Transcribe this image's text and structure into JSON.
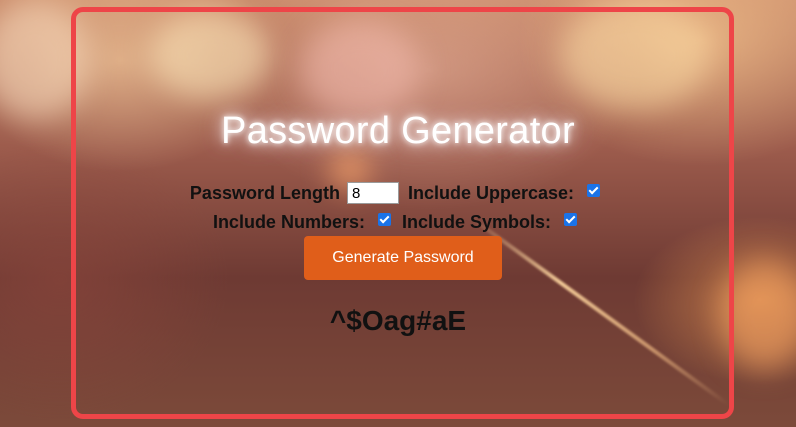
{
  "app": {
    "title": "Password Generator"
  },
  "form": {
    "length_label": "Password Length",
    "length_value": "8",
    "uppercase_label": "Include Uppercase:",
    "uppercase_checked": true,
    "numbers_label": "Include Numbers:",
    "numbers_checked": true,
    "symbols_label": "Include Symbols:",
    "symbols_checked": true
  },
  "actions": {
    "generate_label": "Generate Password"
  },
  "output": {
    "password": "^$Oag#aE"
  },
  "colors": {
    "border": "#ee4548",
    "button": "#e05e1a",
    "checkbox": "#1a73e8"
  }
}
